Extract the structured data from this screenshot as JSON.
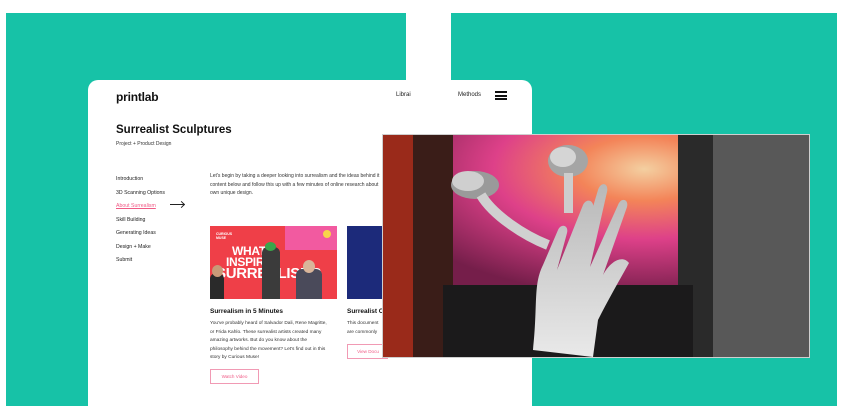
{
  "brand": "printlab",
  "nav": {
    "libraries": "Librai",
    "methods": "Methods"
  },
  "project": {
    "title": "Surrealist Sculptures",
    "subtitle": "Project + Product Design"
  },
  "sidebar": {
    "items": [
      {
        "label": "Introduction"
      },
      {
        "label": "3D Scanning Options"
      },
      {
        "label": "About Surrealism"
      },
      {
        "label": "Skill Building"
      },
      {
        "label": "Generating Ideas"
      },
      {
        "label": "Design + Make"
      },
      {
        "label": "Submit"
      }
    ]
  },
  "intro": {
    "line1": "Let's begin by taking a deeper looking into surrealism and the ideas behind it",
    "line2": "content below and follow this up with a few minutes of online research about",
    "line3": "own unique design."
  },
  "cards": [
    {
      "thumb_tag": "CURIOUS MUSE",
      "thumb_line1": "WHAT",
      "thumb_line2": "INSPIRED",
      "thumb_line3": "SURREALISM?",
      "title": "Surrealism in 5 Minutes",
      "desc": [
        "You've probably heard of Salvador Dali, Rene Magritte,",
        "or Frida Kahlo. These surrealist artists created many",
        "amazing artworks. But do you know about the",
        "philosophy behind the movement? Let's find out in this",
        "story by Curious Muse!"
      ],
      "button": "Watch Video"
    },
    {
      "title": "Surrealist C",
      "desc": [
        "This document",
        "are commonly"
      ],
      "button": "View Docu"
    }
  ],
  "colors": {
    "teal": "#17c2a7",
    "accent": "#f05a85"
  },
  "icons": {
    "menu": "hamburger-menu-icon"
  }
}
